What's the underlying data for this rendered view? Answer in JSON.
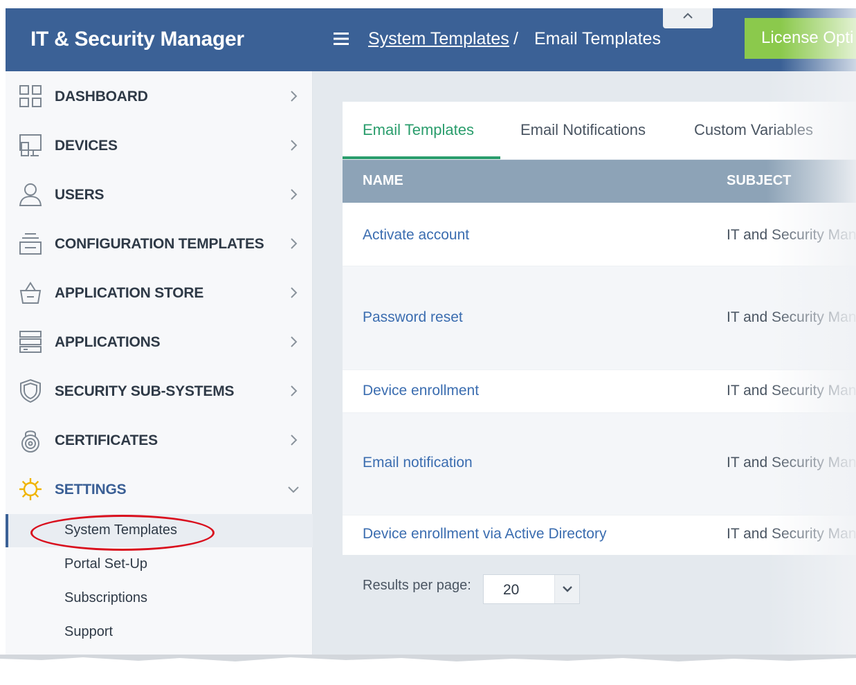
{
  "app": {
    "title": "IT & Security Manager"
  },
  "header": {
    "breadcrumb_link": "System Templates",
    "breadcrumb_sep": "/",
    "breadcrumb_current": "Email Templates",
    "license_button": "License Opti"
  },
  "sidebar": {
    "items": [
      {
        "label": "DASHBOARD",
        "icon": "dashboard-icon"
      },
      {
        "label": "DEVICES",
        "icon": "devices-icon"
      },
      {
        "label": "USERS",
        "icon": "user-icon"
      },
      {
        "label": "CONFIGURATION TEMPLATES",
        "icon": "configuration-templates-icon"
      },
      {
        "label": "APPLICATION STORE",
        "icon": "store-basket-icon"
      },
      {
        "label": "APPLICATIONS",
        "icon": "applications-icon"
      },
      {
        "label": "SECURITY SUB-SYSTEMS",
        "icon": "shield-icon"
      },
      {
        "label": "CERTIFICATES",
        "icon": "certificate-lock-icon"
      },
      {
        "label": "SETTINGS",
        "icon": "gear-icon"
      }
    ],
    "settings_sub": [
      "System Templates",
      "Portal Set-Up",
      "Subscriptions",
      "Support"
    ]
  },
  "tabs": [
    "Email Templates",
    "Email Notifications",
    "Custom Variables"
  ],
  "table": {
    "columns": [
      "NAME",
      "SUBJECT"
    ],
    "rows": [
      {
        "name": "Activate account",
        "subject": "IT and Security Man"
      },
      {
        "name": "Password reset",
        "subject": "IT and Security Man"
      },
      {
        "name": "Device enrollment",
        "subject": "IT and Security Man"
      },
      {
        "name": "Email notification",
        "subject": "IT and Security Man"
      },
      {
        "name": "Device enrollment via Active Directory",
        "subject": "IT and Security Man"
      }
    ]
  },
  "pagination": {
    "label": "Results per page:",
    "value": "20"
  },
  "colors": {
    "header": "#3b6196",
    "accent_green": "#2a9d6c",
    "license": "#8bc94c",
    "link": "#3b6db0",
    "highlight": "#d90f1d"
  }
}
